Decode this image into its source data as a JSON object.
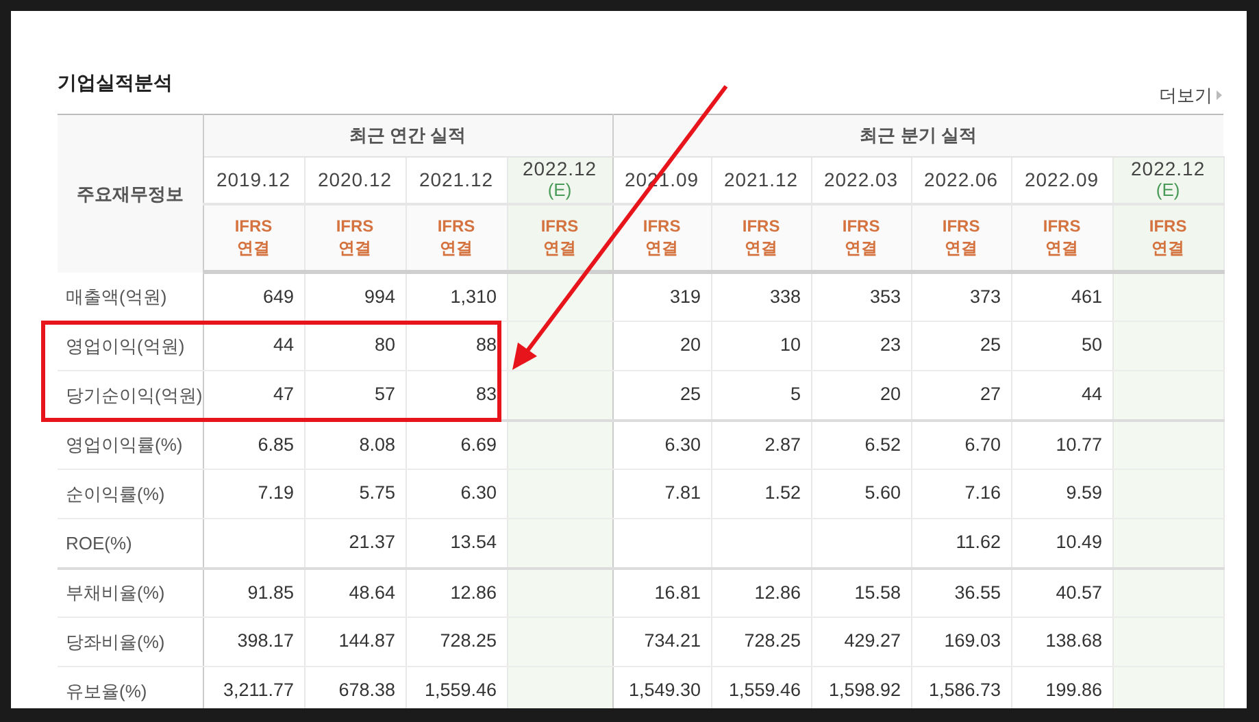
{
  "title": "기업실적분석",
  "more_link": "더보기",
  "table": {
    "corner": "주요재무정보",
    "sections": [
      {
        "label": "최근 연간 실적",
        "columns": [
          {
            "period": "2019.12",
            "estimate": false,
            "basis": [
              "IFRS",
              "연결"
            ]
          },
          {
            "period": "2020.12",
            "estimate": false,
            "basis": [
              "IFRS",
              "연결"
            ]
          },
          {
            "period": "2021.12",
            "estimate": false,
            "basis": [
              "IFRS",
              "연결"
            ]
          },
          {
            "period": "2022.12",
            "estimate": true,
            "estimate_mark": "(E)",
            "basis": [
              "IFRS",
              "연결"
            ]
          }
        ]
      },
      {
        "label": "최근 분기 실적",
        "columns": [
          {
            "period": "2021.09",
            "estimate": false,
            "basis": [
              "IFRS",
              "연결"
            ]
          },
          {
            "period": "2021.12",
            "estimate": false,
            "basis": [
              "IFRS",
              "연결"
            ]
          },
          {
            "period": "2022.03",
            "estimate": false,
            "basis": [
              "IFRS",
              "연결"
            ]
          },
          {
            "period": "2022.06",
            "estimate": false,
            "basis": [
              "IFRS",
              "연결"
            ]
          },
          {
            "period": "2022.09",
            "estimate": false,
            "basis": [
              "IFRS",
              "연결"
            ]
          },
          {
            "period": "2022.12",
            "estimate": true,
            "estimate_mark": "(E)",
            "basis": [
              "IFRS",
              "연결"
            ]
          }
        ]
      }
    ],
    "groups": [
      {
        "rows": [
          {
            "label": "매출액(억원)",
            "highlighted": false,
            "values": {
              "0": "649",
              "1": "994",
              "2": "1,310",
              "4": "319",
              "5": "338",
              "6": "353",
              "7": "373",
              "8": "461"
            }
          },
          {
            "label": "영업이익(억원)",
            "highlighted": true,
            "values": {
              "0": "44",
              "1": "80",
              "2": "88",
              "4": "20",
              "5": "10",
              "6": "23",
              "7": "25",
              "8": "50"
            }
          },
          {
            "label": "당기순이익(억원)",
            "highlighted": true,
            "values": {
              "0": "47",
              "1": "57",
              "2": "83",
              "4": "25",
              "5": "5",
              "6": "20",
              "7": "27",
              "8": "44"
            }
          }
        ]
      },
      {
        "rows": [
          {
            "label": "영업이익률(%)",
            "highlighted": false,
            "values": {
              "0": "6.85",
              "1": "8.08",
              "2": "6.69",
              "4": "6.30",
              "5": "2.87",
              "6": "6.52",
              "7": "6.70",
              "8": "10.77"
            }
          },
          {
            "label": "순이익률(%)",
            "highlighted": false,
            "values": {
              "0": "7.19",
              "1": "5.75",
              "2": "6.30",
              "4": "7.81",
              "5": "1.52",
              "6": "5.60",
              "7": "7.16",
              "8": "9.59"
            }
          },
          {
            "label": "ROE(%)",
            "highlighted": false,
            "values": {
              "1": "21.37",
              "2": "13.54",
              "7": "11.62",
              "8": "10.49"
            }
          }
        ]
      },
      {
        "rows": [
          {
            "label": "부채비율(%)",
            "highlighted": false,
            "values": {
              "0": "91.85",
              "1": "48.64",
              "2": "12.86",
              "4": "16.81",
              "5": "12.86",
              "6": "15.58",
              "7": "36.55",
              "8": "40.57"
            }
          },
          {
            "label": "당좌비율(%)",
            "highlighted": false,
            "values": {
              "0": "398.17",
              "1": "144.87",
              "2": "728.25",
              "4": "734.21",
              "5": "728.25",
              "6": "429.27",
              "7": "169.03",
              "8": "138.68"
            }
          },
          {
            "label": "유보율(%)",
            "highlighted": false,
            "values": {
              "0": "3,211.77",
              "1": "678.38",
              "2": "1,559.46",
              "4": "1,549.30",
              "5": "1,559.46",
              "6": "1,598.92",
              "7": "1,586.73",
              "8": "199.86"
            }
          }
        ]
      }
    ]
  },
  "annotation": {
    "arrow": true
  }
}
